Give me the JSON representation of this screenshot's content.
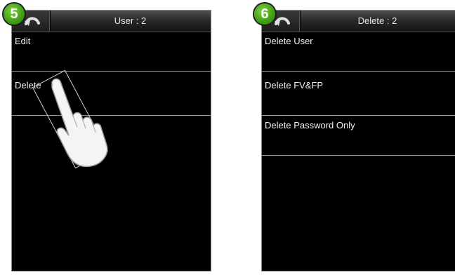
{
  "left_screen": {
    "step": "5",
    "title": "User : 2",
    "items": [
      {
        "label": "Edit"
      },
      {
        "label": "Delete"
      }
    ]
  },
  "right_screen": {
    "step": "6",
    "title": "Delete : 2",
    "items": [
      {
        "label": "Delete User"
      },
      {
        "label": "Delete FV&FP"
      },
      {
        "label": "Delete Password Only"
      }
    ]
  },
  "colors": {
    "badge_green": "#3f9e14",
    "screen_bg": "#000000",
    "text": "#f2f2f2"
  },
  "icons": {
    "back": "back-arrow-icon",
    "gesture": "tap-hand-icon"
  }
}
